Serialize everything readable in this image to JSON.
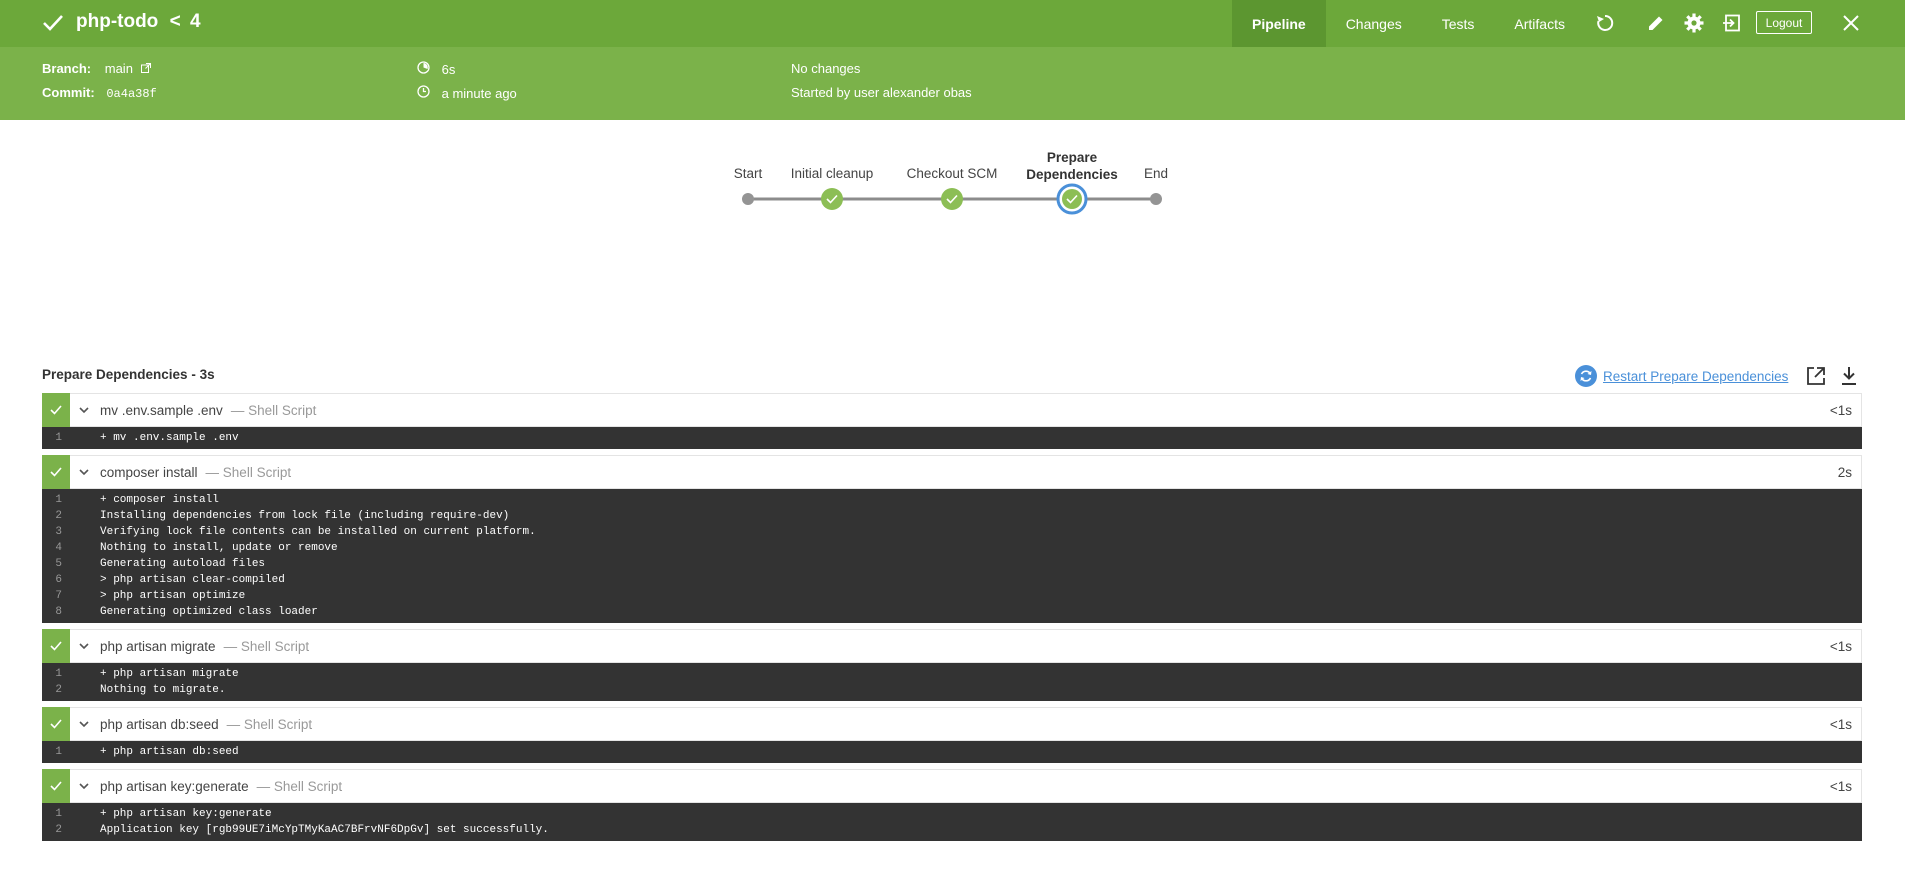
{
  "header": {
    "title": "php-todo",
    "run_number": "4",
    "tabs": [
      "Pipeline",
      "Changes",
      "Tests",
      "Artifacts"
    ],
    "active_tab": "Pipeline",
    "logout_label": "Logout",
    "colors": {
      "topbar": "#6ca83a",
      "subbar": "#7bb24a",
      "active_tab": "#5c9630"
    },
    "icons": [
      "check-icon",
      "chevron-left-icon",
      "replay-icon",
      "pencil-icon",
      "gear-icon",
      "exit-icon",
      "close-icon"
    ]
  },
  "run_info": {
    "branch_label": "Branch:",
    "branch": "main",
    "commit_label": "Commit:",
    "commit": "0a4a38f",
    "duration": "6s",
    "started": "a minute ago",
    "changes": "No changes",
    "started_by": "Started by user alexander obas"
  },
  "stages": [
    {
      "label": "Start",
      "status": "none"
    },
    {
      "label": "Initial cleanup",
      "status": "success"
    },
    {
      "label": "Checkout SCM",
      "status": "success"
    },
    {
      "label": "Prepare Dependencies",
      "label_line1": "Prepare",
      "label_line2": "Dependencies",
      "status": "success",
      "selected": true
    },
    {
      "label": "End",
      "status": "none"
    }
  ],
  "section": {
    "title": "Prepare Dependencies - 3s",
    "restart_label": "Restart Prepare Dependencies"
  },
  "steps": [
    {
      "name": "mv .env.sample .env",
      "type": "— Shell Script",
      "duration": "<1s",
      "log": [
        "+ mv .env.sample .env"
      ]
    },
    {
      "name": "composer install",
      "type": "— Shell Script",
      "duration": "2s",
      "log": [
        "+ composer install",
        "Installing dependencies from lock file (including require-dev)",
        "Verifying lock file contents can be installed on current platform.",
        "Nothing to install, update or remove",
        "Generating autoload files",
        "> php artisan clear-compiled",
        "> php artisan optimize",
        "Generating optimized class loader"
      ]
    },
    {
      "name": "php artisan migrate",
      "type": "— Shell Script",
      "duration": "<1s",
      "log": [
        "+ php artisan migrate",
        "Nothing to migrate."
      ]
    },
    {
      "name": "php artisan db:seed",
      "type": "— Shell Script",
      "duration": "<1s",
      "log": [
        "+ php artisan db:seed"
      ]
    },
    {
      "name": "php artisan key:generate",
      "type": "— Shell Script",
      "duration": "<1s",
      "log": [
        "+ php artisan key:generate",
        "Application key [rgb99UE7iMcYpTMyKaAC7BFrvNF6DpGv] set successfully."
      ]
    }
  ]
}
